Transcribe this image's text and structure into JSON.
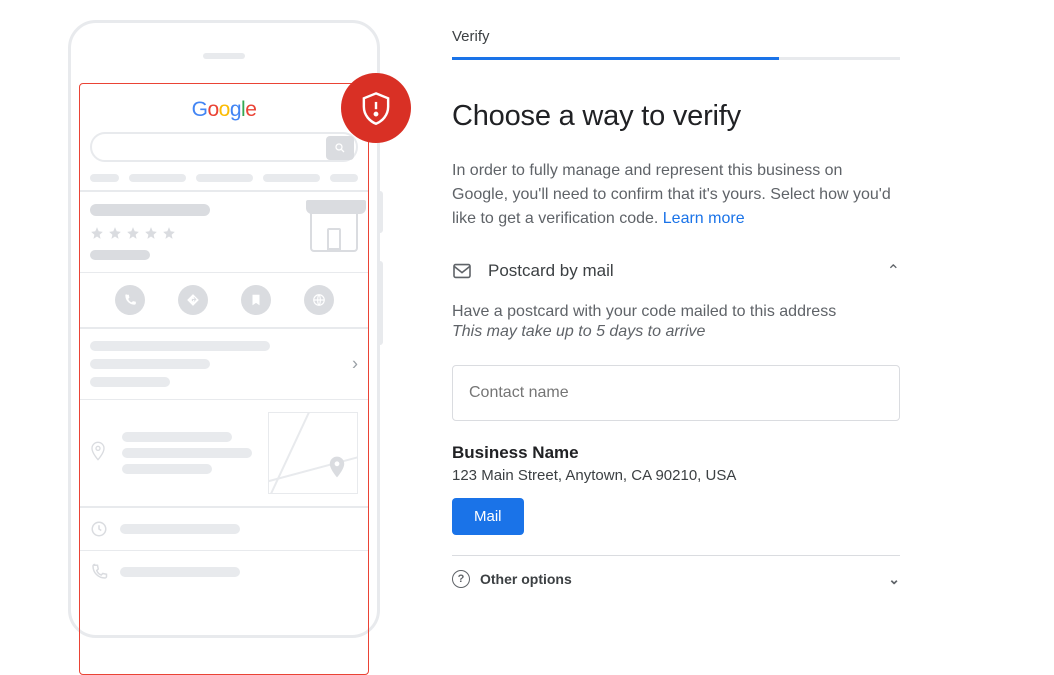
{
  "tab": "Verify",
  "heading": "Choose a way to verify",
  "description": "In order to fully manage and represent this business on Google, you'll need to confirm that it's yours. Select how you'd like to get a verification code. ",
  "learn_more": "Learn more",
  "option": {
    "title": "Postcard by mail",
    "line1": "Have a postcard with your code mailed to this address",
    "line2": "This may take up to 5 days to arrive"
  },
  "input_placeholder": "Contact name",
  "business": {
    "name": "Business Name",
    "address": "123 Main Street, Anytown, CA 90210, USA"
  },
  "mail_btn": "Mail",
  "other_options": "Other options",
  "logo": "Google",
  "progress_percent": 73
}
